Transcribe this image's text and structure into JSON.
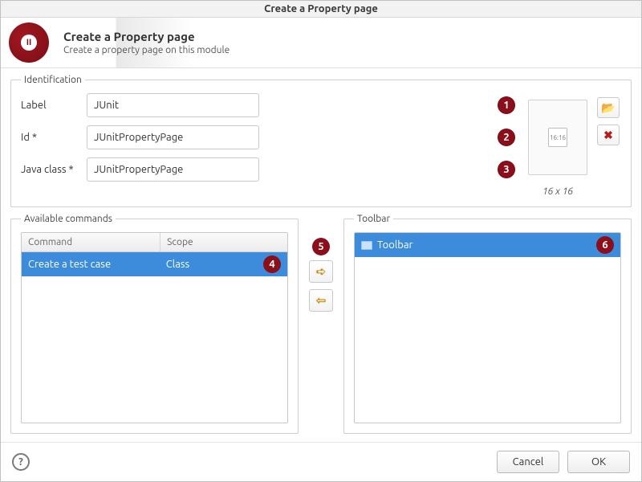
{
  "window": {
    "title": "Create a Property page"
  },
  "header": {
    "title": "Create a Property page",
    "subtitle": "Create a property page on this module"
  },
  "identification": {
    "legend": "Identification",
    "label_label": "Label",
    "label_value": "JUnit",
    "id_label": "Id *",
    "id_value": "JUnitPropertyPage",
    "javaclass_label": "Java class *",
    "javaclass_value": "JUnitPropertyPage",
    "size_label": "16 x 16"
  },
  "badges": {
    "b1": "1",
    "b2": "2",
    "b3": "3",
    "b4": "4",
    "b5": "5",
    "b6": "6"
  },
  "available": {
    "legend": "Available commands",
    "columns": {
      "command": "Command",
      "scope": "Scope"
    },
    "rows": [
      {
        "command": "Create a test case",
        "scope": "Class"
      }
    ]
  },
  "toolbar": {
    "legend": "Toolbar",
    "root_label": "Toolbar"
  },
  "footer": {
    "help": "?",
    "cancel": "Cancel",
    "ok": "OK"
  },
  "icons": {
    "browse": "📂",
    "remove": "✖",
    "right": "➪",
    "left": "⇦",
    "thumb": "16:16"
  }
}
